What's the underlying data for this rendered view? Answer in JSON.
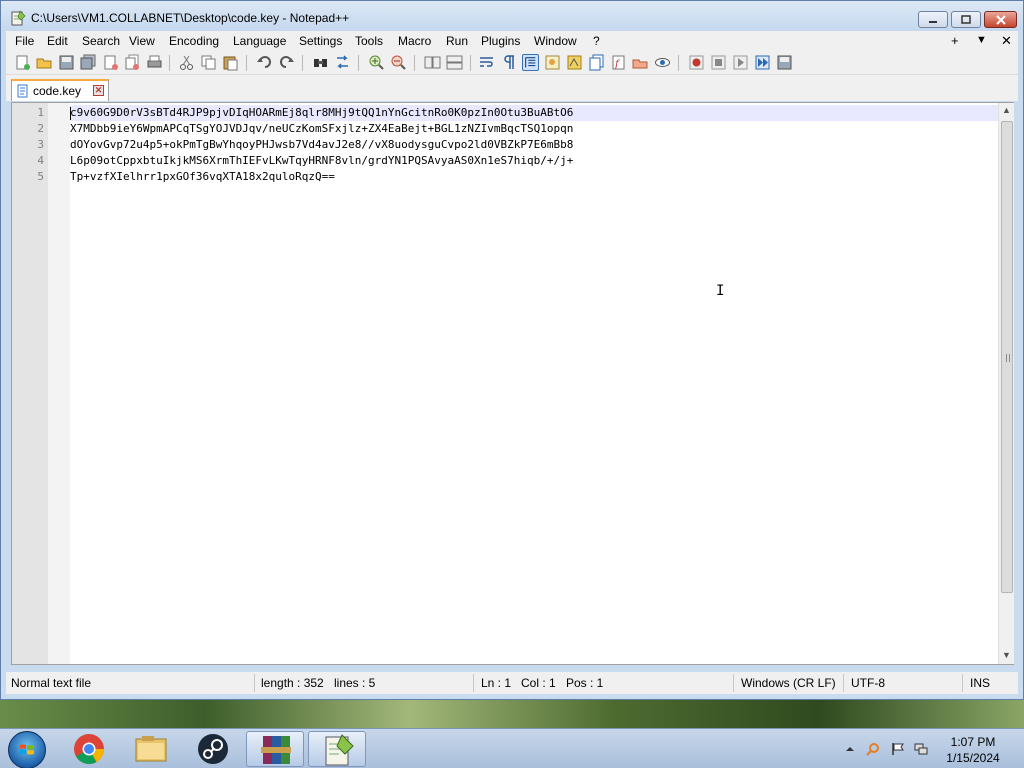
{
  "window": {
    "title": "C:\\Users\\VM1.COLLABNET\\Desktop\\code.key - Notepad++"
  },
  "menu": {
    "file": "File",
    "edit": "Edit",
    "search": "Search",
    "view": "View",
    "encoding": "Encoding",
    "language": "Language",
    "settings": "Settings",
    "tools": "Tools",
    "macro": "Macro",
    "run": "Run",
    "plugins": "Plugins",
    "window": "Window",
    "help": "?",
    "plus": "+",
    "dropdown": "▼",
    "close": "✕"
  },
  "tab": {
    "label": "code.key",
    "close": "✕"
  },
  "editor": {
    "lines": [
      {
        "num": "1",
        "text": "c9v60G9D0rV3sBTd4RJP9pjvDIqHOARmEj8qlr8MHj9tQQ1nYnGcitnRo0K0pzIn0Otu3BuABtO6"
      },
      {
        "num": "2",
        "text": "X7MDbb9ieY6WpmAPCqTSgYOJVDJqv/neUCzKomSFxjlz+ZX4EaBejt+BGL1zNZIvmBqcTSQ1opqn"
      },
      {
        "num": "3",
        "text": "dOYovGvp72u4p5+okPmTgBwYhqoyPHJwsb7Vd4avJ2e8//vX8uodysguCvpo2ld0VBZkP7E6mBb8"
      },
      {
        "num": "4",
        "text": "L6p09otCppxbtuIkjkMS6XrmThIEFvLKwTqyHRNF8vln/grdYN1PQSAvyaAS0Xn1eS7hiqb/+/j+"
      },
      {
        "num": "5",
        "text": "Tp+vzfXIelhrr1pxGOf36vqXTA18x2quloRqzQ=="
      }
    ]
  },
  "status": {
    "filetype": "Normal text file",
    "length": "length : 352",
    "lines": "lines : 5",
    "ln": "Ln : 1",
    "col": "Col : 1",
    "pos": "Pos : 1",
    "eol": "Windows (CR LF)",
    "encoding": "UTF-8",
    "mode": "INS"
  },
  "taskbar": {
    "time": "1:07 PM",
    "date": "1/15/2024"
  },
  "icons": {
    "app": "notepad-plus-plus-icon",
    "start": "windows-start-icon",
    "chrome": "chrome-icon",
    "explorer": "file-explorer-icon",
    "steam": "steam-icon",
    "winrar": "winrar-icon"
  }
}
